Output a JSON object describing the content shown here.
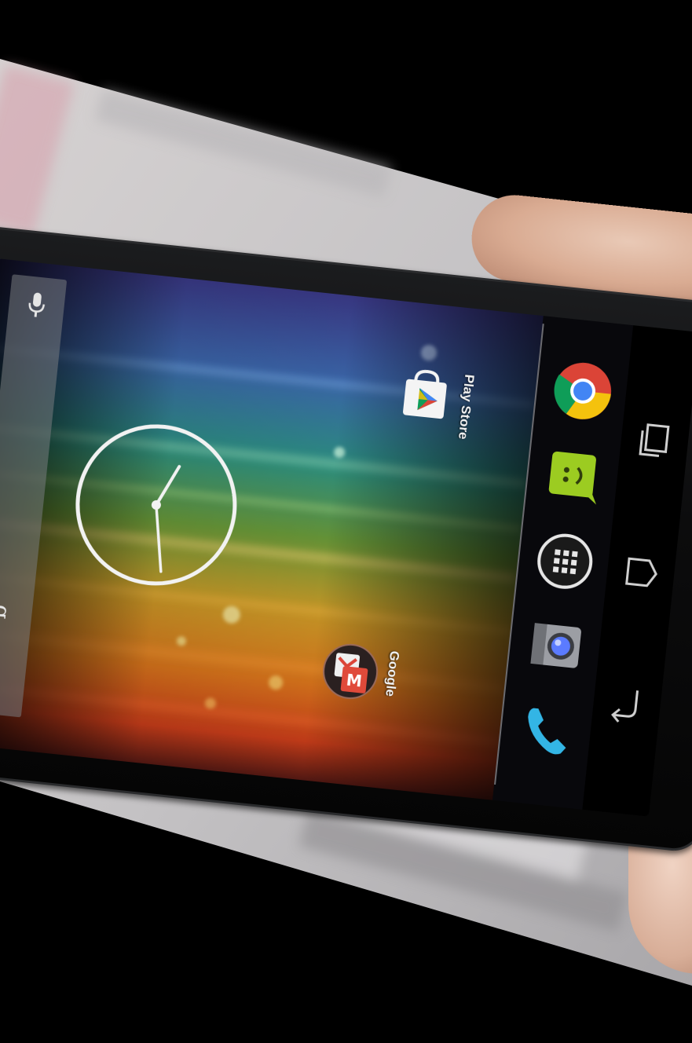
{
  "home_screen": {
    "apps": [
      {
        "label": "Play Store",
        "icon": "play-store-icon"
      },
      {
        "label": "Google",
        "icon": "google-folder-icon"
      }
    ]
  },
  "search_bar": {
    "mic_icon": "microphone-icon"
  },
  "clock": {
    "type": "analog",
    "hour_hand_angle_deg": 25,
    "minute_hand_angle_deg": 170
  },
  "dock": {
    "items": [
      "chrome-icon",
      "messaging-icon",
      "app-drawer-icon",
      "camera-icon",
      "phone-icon"
    ]
  },
  "navbar": {
    "buttons": [
      "recent-apps-icon",
      "home-icon",
      "back-icon"
    ]
  },
  "colors": {
    "chrome_red": "#db4437",
    "chrome_yellow": "#f4c20d",
    "chrome_green": "#0f9d58",
    "chrome_blue": "#4285f4",
    "messaging_green": "#9ccc21",
    "phone_blue": "#33b5e5"
  }
}
